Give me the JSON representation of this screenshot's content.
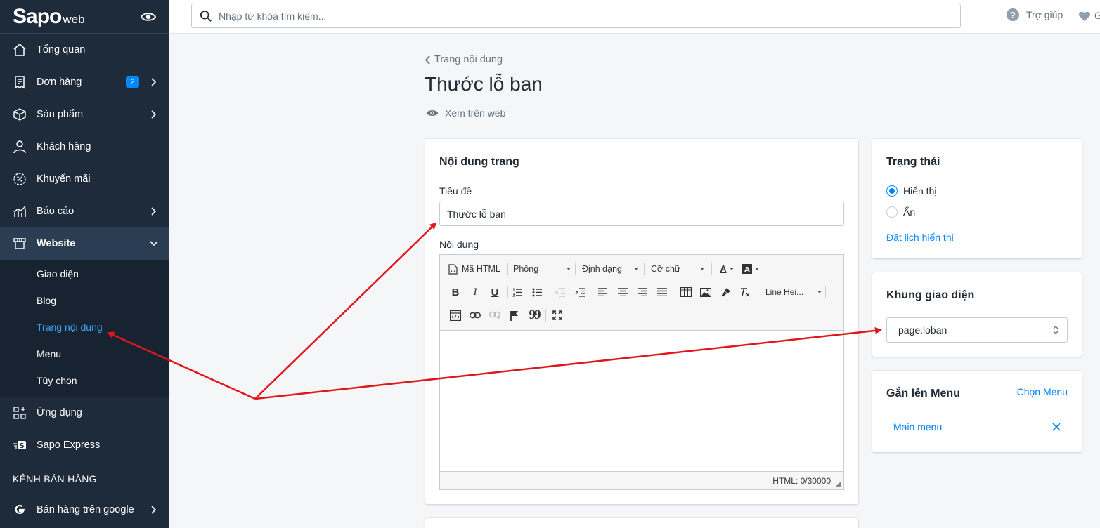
{
  "sidebar": {
    "logo_main": "Sapo",
    "logo_sub": "web",
    "items": [
      {
        "label": "Tổng quan"
      },
      {
        "label": "Đơn hàng",
        "badge": "2"
      },
      {
        "label": "Sản phẩm"
      },
      {
        "label": "Khách hàng"
      },
      {
        "label": "Khuyến mãi"
      },
      {
        "label": "Báo cáo"
      },
      {
        "label": "Website"
      }
    ],
    "website_sub": [
      {
        "label": "Giao diện"
      },
      {
        "label": "Blog"
      },
      {
        "label": "Trang nội dung"
      },
      {
        "label": "Menu"
      },
      {
        "label": "Tùy chọn"
      }
    ],
    "apps_label": "Ứng dụng",
    "express_label": "Sapo Express",
    "channels_heading": "KÊNH BÁN HÀNG",
    "google_label": "Bán hàng trên google"
  },
  "topbar": {
    "search_placeholder": "Nhập từ khóa tìm kiếm...",
    "help_label": "Trợ giúp",
    "help_glyph": "?",
    "partial_text": "G"
  },
  "page": {
    "breadcrumb": "Trang nội dung",
    "title": "Thước lỗ ban",
    "view_web": "Xem trên web"
  },
  "content_card": {
    "heading": "Nội dung trang",
    "title_label": "Tiêu đề",
    "title_value": "Thước lỗ ban",
    "content_label": "Nội dung",
    "toolbar": {
      "html": "Mã HTML",
      "font": "Phông",
      "format": "Định dạng",
      "size": "Cỡ chữ",
      "line_height": "Line Hei...",
      "bold": "B",
      "italic": "I",
      "underline": "U",
      "text_color": "A",
      "quote": "99"
    },
    "html_counter": "HTML: 0/30000"
  },
  "status_card": {
    "heading": "Trạng thái",
    "options": [
      "Hiển thị",
      "Ẩn"
    ],
    "schedule_link": "Đặt lịch hiển thị"
  },
  "theme_card": {
    "heading": "Khung giao diện",
    "selected": "page.loban"
  },
  "menu_card": {
    "heading": "Gắn lên Menu",
    "choose_link": "Chọn Menu",
    "items": [
      "Main menu"
    ]
  },
  "colors": {
    "sidebar_bg": "#1e2b3a",
    "accent": "#0084ff",
    "annotation_arrow": "#e0161b"
  }
}
